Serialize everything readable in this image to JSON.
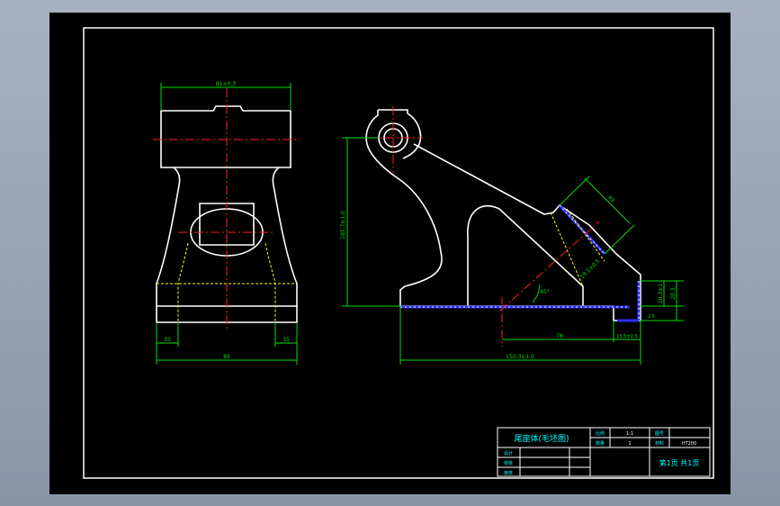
{
  "drawing": {
    "front_view": {
      "top_width_dim": "81±0.3",
      "left_small_dim": "35",
      "right_small_dim": "35",
      "bottom_width_dim": "89"
    },
    "side_view": {
      "height_dim": "185.7±1.0",
      "slant_len_dim": "49",
      "slant_thick_dim": "19.1±0.5",
      "angle_dim": "45°",
      "right_small_dim_1": "10.3±1",
      "right_small_dim_2": "20.3",
      "right_small_dim_3": "2.5",
      "mid_dim": "78",
      "mid_right_dim": "15.6±0.5",
      "bottom_width_dim": "150.3±1.0"
    }
  },
  "title_block": {
    "title": "尾座体(毛坯图)",
    "scale_label": "比例",
    "scale_value": "1:1",
    "quantity_label": "数量",
    "quantity_value": "1",
    "drawing_no_label": "图号",
    "drawing_no_value": "",
    "material_label": "材料",
    "material_value": "HT200",
    "designer_label": "设计",
    "checker_label": "校核",
    "reviewer_label": "审核",
    "sheet_info": "第1页  共1页"
  },
  "colors": {
    "outline": "#ffffff",
    "centerline": "#ff2020",
    "dimension": "#00e000",
    "hidden": "#ffff00",
    "machining": "#3030ff",
    "text": "#00ffff"
  }
}
